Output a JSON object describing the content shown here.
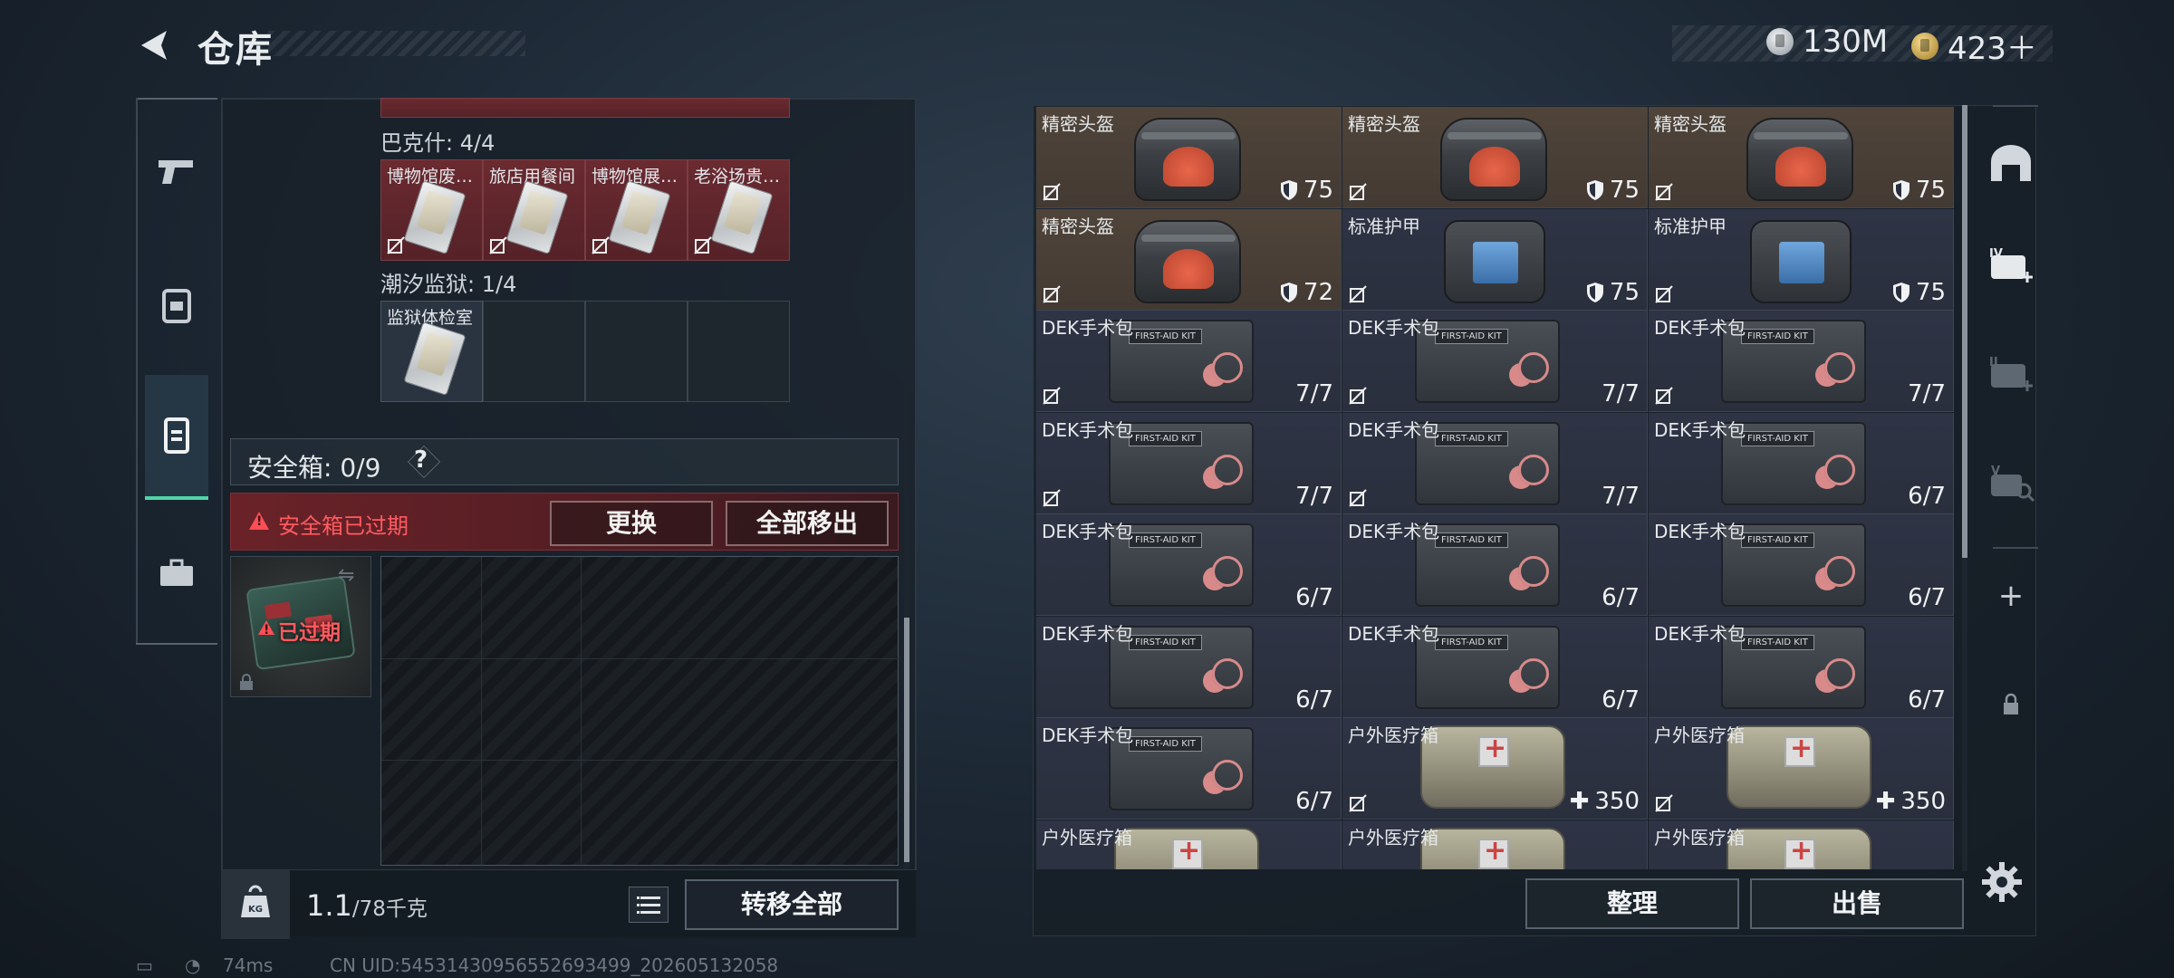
{
  "header": {
    "title": "仓库",
    "currency": [
      {
        "icon": "silver-coin-icon",
        "value": "130M"
      },
      {
        "icon": "gold-coin-icon",
        "value": "423＋"
      }
    ]
  },
  "left_nav": [
    "pistol-icon",
    "backpack-icon",
    "storage-icon",
    "briefcase-icon"
  ],
  "sections": [
    {
      "label": "巴克什: 4/4",
      "slots": [
        "博物馆废…",
        "旅店用餐间",
        "博物馆展…",
        "老浴场贵…"
      ]
    },
    {
      "label": "潮汐监狱: 1/4",
      "slots": [
        "监狱体检室"
      ]
    }
  ],
  "safebox": {
    "title": "安全箱: 0/9",
    "help": "?",
    "expired_message": "安全箱已过期",
    "replace_button": "更换",
    "move_all_button": "全部移出",
    "slot_status": "已过期"
  },
  "left_footer": {
    "weight_value": "1.1",
    "weight_capacity": "/78千克",
    "transfer_all_button": "转移全部"
  },
  "stash": [
    {
      "name": "精密头盔",
      "value": "75",
      "kind": "helmet",
      "bg": "brown",
      "badge": "shield",
      "nosell": true
    },
    {
      "name": "精密头盔",
      "value": "75",
      "kind": "helmet",
      "bg": "brown",
      "badge": "shield",
      "nosell": true
    },
    {
      "name": "精密头盔",
      "value": "75",
      "kind": "helmet",
      "bg": "brown",
      "badge": "shield",
      "nosell": true
    },
    {
      "name": "精密头盔",
      "value": "72",
      "kind": "helmet",
      "bg": "brown",
      "badge": "shield",
      "nosell": true
    },
    {
      "name": "标准护甲",
      "value": "75",
      "kind": "armor",
      "bg": "blue",
      "badge": "shield",
      "nosell": true
    },
    {
      "name": "标准护甲",
      "value": "75",
      "kind": "armor",
      "bg": "blue",
      "badge": "shield",
      "nosell": true
    },
    {
      "name": "DEK手术包",
      "value": "7/7",
      "kind": "medkit",
      "bg": "blue",
      "badge": "",
      "nosell": true
    },
    {
      "name": "DEK手术包",
      "value": "7/7",
      "kind": "medkit",
      "bg": "blue",
      "badge": "",
      "nosell": true
    },
    {
      "name": "DEK手术包",
      "value": "7/7",
      "kind": "medkit",
      "bg": "blue",
      "badge": "",
      "nosell": true
    },
    {
      "name": "DEK手术包",
      "value": "7/7",
      "kind": "medkit",
      "bg": "blue",
      "badge": "",
      "nosell": true
    },
    {
      "name": "DEK手术包",
      "value": "7/7",
      "kind": "medkit",
      "bg": "blue",
      "badge": "",
      "nosell": true
    },
    {
      "name": "DEK手术包",
      "value": "6/7",
      "kind": "medkit",
      "bg": "blue",
      "badge": "",
      "nosell": false
    },
    {
      "name": "DEK手术包",
      "value": "6/7",
      "kind": "medkit",
      "bg": "blue",
      "badge": "",
      "nosell": false
    },
    {
      "name": "DEK手术包",
      "value": "6/7",
      "kind": "medkit",
      "bg": "blue",
      "badge": "",
      "nosell": false
    },
    {
      "name": "DEK手术包",
      "value": "6/7",
      "kind": "medkit",
      "bg": "blue",
      "badge": "",
      "nosell": false
    },
    {
      "name": "DEK手术包",
      "value": "6/7",
      "kind": "medkit",
      "bg": "blue",
      "badge": "",
      "nosell": false
    },
    {
      "name": "DEK手术包",
      "value": "6/7",
      "kind": "medkit",
      "bg": "blue",
      "badge": "",
      "nosell": false
    },
    {
      "name": "DEK手术包",
      "value": "6/7",
      "kind": "medkit",
      "bg": "blue",
      "badge": "",
      "nosell": false
    },
    {
      "name": "DEK手术包",
      "value": "6/7",
      "kind": "medkit",
      "bg": "blue",
      "badge": "",
      "nosell": false
    },
    {
      "name": "户外医疗箱",
      "value": "350",
      "kind": "outdoor",
      "bg": "blue",
      "badge": "plus",
      "nosell": true
    },
    {
      "name": "户外医疗箱",
      "value": "350",
      "kind": "outdoor",
      "bg": "blue",
      "badge": "plus",
      "nosell": true
    },
    {
      "name": "户外医疗箱",
      "value": "",
      "kind": "outdoor",
      "bg": "blue",
      "badge": "",
      "nosell": false
    },
    {
      "name": "户外医疗箱",
      "value": "",
      "kind": "outdoor",
      "bg": "blue",
      "badge": "",
      "nosell": false
    },
    {
      "name": "户外医疗箱",
      "value": "",
      "kind": "outdoor",
      "bg": "blue",
      "badge": "",
      "nosell": false
    }
  ],
  "right_footer": {
    "sort_button": "整理",
    "sell_button": "出售"
  },
  "right_nav": [
    "vault-icon",
    "level-iv-add-icon",
    "level-ii-add-icon",
    "level-v-search-icon",
    "add-icon",
    "lock-icon"
  ],
  "status_bar": {
    "latency": "74ms",
    "uid": "CN UID:54531430956552693499_202605132058"
  },
  "colors": {
    "accent_green": "#4fd6a8",
    "warning_red": "#ff5a5f",
    "rare_brown": "#50443a",
    "common_blue": "#2e3445"
  }
}
